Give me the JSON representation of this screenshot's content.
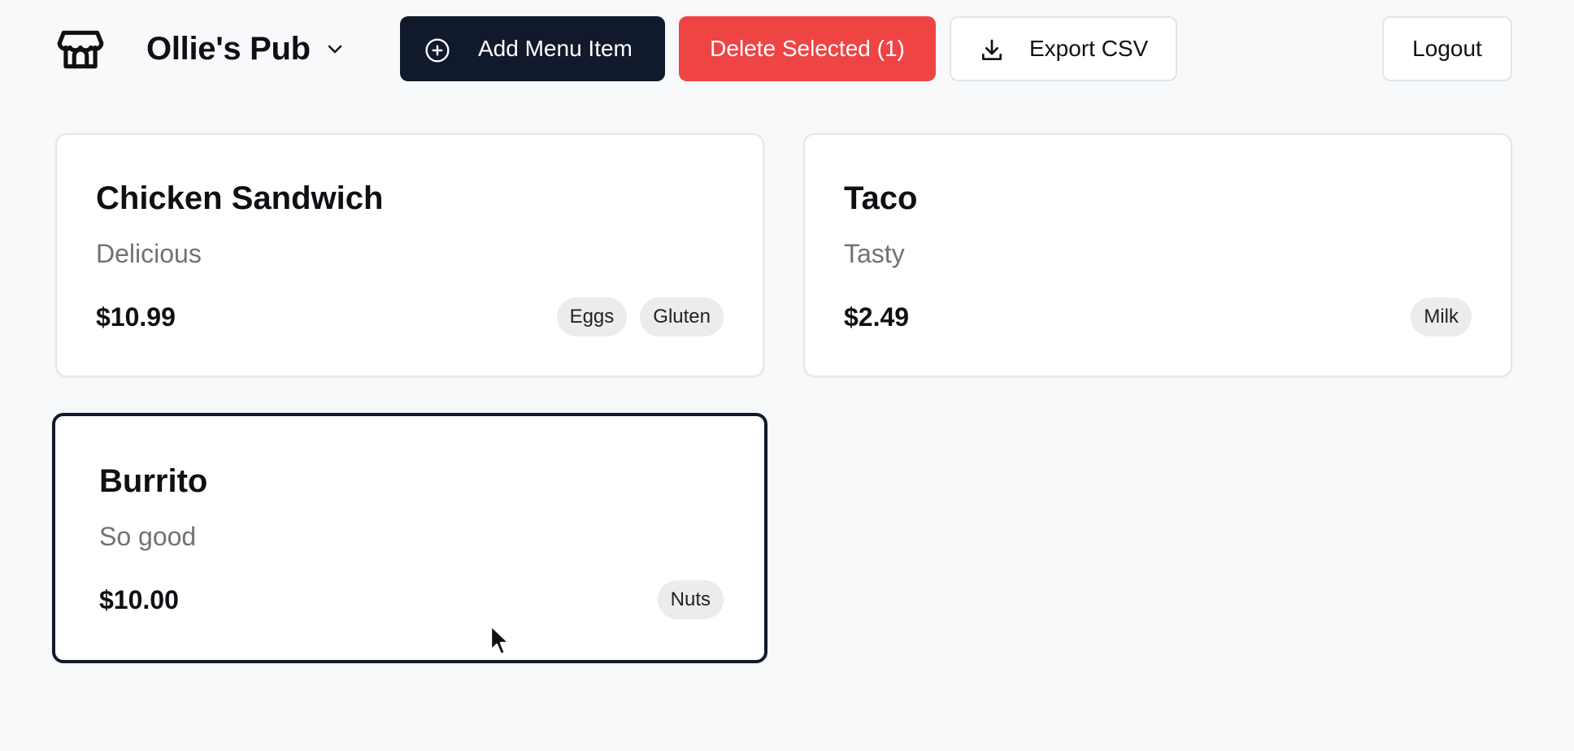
{
  "header": {
    "store_icon": "storefront-icon",
    "store_name": "Ollie's Pub",
    "chevron_icon": "chevron-down-icon",
    "buttons": {
      "add_label": "Add Menu Item",
      "add_icon": "plus-circle-icon",
      "delete_label": "Delete Selected (1)",
      "export_label": "Export CSV",
      "export_icon": "download-icon",
      "logout_label": "Logout"
    }
  },
  "colors": {
    "primary_dark": "#111a2c",
    "danger": "#ef4444",
    "background": "#f8f9fb",
    "tag_bg": "#ebecee",
    "muted_text": "#76716c"
  },
  "menu_items": [
    {
      "name": "Chicken Sandwich",
      "description": "Delicious",
      "price": "$10.99",
      "allergens": [
        "Eggs",
        "Gluten"
      ],
      "selected": false
    },
    {
      "name": "Taco",
      "description": "Tasty",
      "price": "$2.49",
      "allergens": [
        "Milk"
      ],
      "selected": false
    },
    {
      "name": "Burrito",
      "description": "So good",
      "price": "$10.00",
      "allergens": [
        "Nuts"
      ],
      "selected": true
    }
  ]
}
